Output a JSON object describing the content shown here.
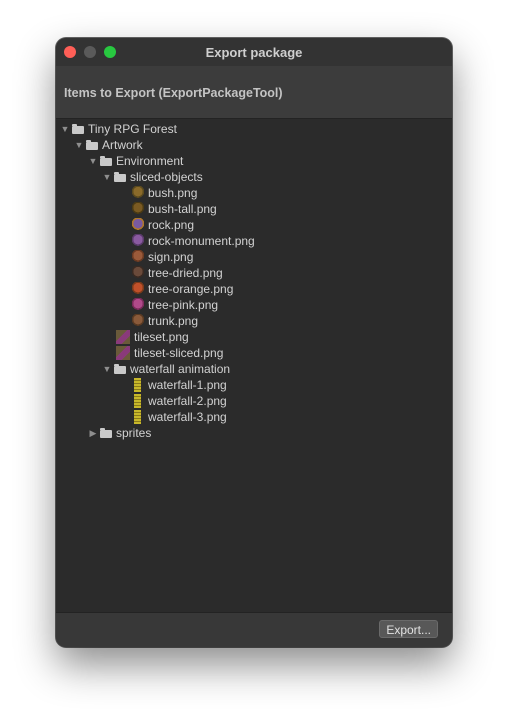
{
  "window": {
    "title": "Export package"
  },
  "header": {
    "title": "Items to Export (ExportPackageTool)"
  },
  "tree": [
    {
      "label": "Tiny RPG Forest",
      "depth": 0,
      "kind": "folder",
      "state": "expanded"
    },
    {
      "label": "Artwork",
      "depth": 1,
      "kind": "folder",
      "state": "expanded"
    },
    {
      "label": "Environment",
      "depth": 2,
      "kind": "folder",
      "state": "expanded"
    },
    {
      "label": "sliced-objects",
      "depth": 3,
      "kind": "folder",
      "state": "expanded"
    },
    {
      "label": "bush.png",
      "depth": 4,
      "kind": "image",
      "icon": "bush-thumbnail-icon",
      "colors": [
        "#8a6a2a",
        "#5b4a1e"
      ]
    },
    {
      "label": "bush-tall.png",
      "depth": 4,
      "kind": "image",
      "icon": "bush-tall-thumbnail-icon",
      "colors": [
        "#7a5a22",
        "#4a3a14"
      ]
    },
    {
      "label": "rock.png",
      "depth": 4,
      "kind": "image",
      "icon": "rock-thumbnail-icon",
      "colors": [
        "#7a5aa0",
        "#b0782a"
      ]
    },
    {
      "label": "rock-monument.png",
      "depth": 4,
      "kind": "image",
      "icon": "rock-monument-thumbnail-icon",
      "colors": [
        "#8a5aa0",
        "#5a3a6a"
      ]
    },
    {
      "label": "sign.png",
      "depth": 4,
      "kind": "image",
      "icon": "sign-thumbnail-icon",
      "colors": [
        "#9a5a3a",
        "#6a3a22"
      ]
    },
    {
      "label": "tree-dried.png",
      "depth": 4,
      "kind": "image",
      "icon": "tree-dried-thumbnail-icon",
      "colors": [
        "#6a4a3a",
        "#3a2a22"
      ]
    },
    {
      "label": "tree-orange.png",
      "depth": 4,
      "kind": "image",
      "icon": "tree-orange-thumbnail-icon",
      "colors": [
        "#c0502a",
        "#7a3a1a"
      ]
    },
    {
      "label": "tree-pink.png",
      "depth": 4,
      "kind": "image",
      "icon": "tree-pink-thumbnail-icon",
      "colors": [
        "#b04a8a",
        "#7a2a5a"
      ]
    },
    {
      "label": "trunk.png",
      "depth": 4,
      "kind": "image",
      "icon": "trunk-thumbnail-icon",
      "colors": [
        "#8a5a3a",
        "#5a3a22"
      ]
    },
    {
      "label": "tileset.png",
      "depth": 3,
      "kind": "image",
      "icon": "tileset-thumbnail-icon",
      "colors": [
        "#6a5a3a",
        "#8a3a7a"
      ]
    },
    {
      "label": "tileset-sliced.png",
      "depth": 3,
      "kind": "image",
      "icon": "tileset-sliced-thumbnail-icon",
      "colors": [
        "#6a5a3a",
        "#8a3a7a"
      ]
    },
    {
      "label": "waterfall animation",
      "depth": 3,
      "kind": "folder",
      "state": "expanded"
    },
    {
      "label": "waterfall-1.png",
      "depth": 4,
      "kind": "image",
      "icon": "waterfall-1-thumbnail-icon",
      "colors": [
        "#c8b82a",
        "#8a7a1a"
      ]
    },
    {
      "label": "waterfall-2.png",
      "depth": 4,
      "kind": "image",
      "icon": "waterfall-2-thumbnail-icon",
      "colors": [
        "#c8b82a",
        "#8a7a1a"
      ]
    },
    {
      "label": "waterfall-3.png",
      "depth": 4,
      "kind": "image",
      "icon": "waterfall-3-thumbnail-icon",
      "colors": [
        "#c8b82a",
        "#8a7a1a"
      ]
    },
    {
      "label": "sprites",
      "depth": 2,
      "kind": "folder",
      "state": "collapsed"
    }
  ],
  "footer": {
    "export_label": "Export..."
  },
  "colors": {
    "close": "#ff5f57",
    "minimize": "#5a5a5a",
    "maximize": "#28c840"
  }
}
